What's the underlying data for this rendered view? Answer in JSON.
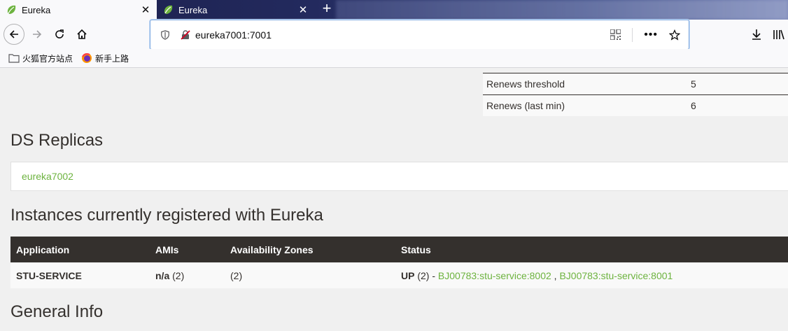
{
  "browser": {
    "tabs": [
      {
        "title": "Eureka",
        "active": true
      },
      {
        "title": "Eureka",
        "active": false
      }
    ],
    "new_tab_label": "+",
    "url": "eureka7001:7001",
    "bookmarks": [
      {
        "label": "火狐官方站点",
        "icon": "folder-icon"
      },
      {
        "label": "新手上路",
        "icon": "firefox-icon"
      }
    ]
  },
  "renewals": [
    {
      "label": "Renews threshold",
      "value": "5"
    },
    {
      "label": "Renews (last min)",
      "value": "6"
    }
  ],
  "ds_replicas": {
    "heading": "DS Replicas",
    "items": [
      "eureka7002"
    ]
  },
  "instances": {
    "heading": "Instances currently registered with Eureka",
    "columns": [
      "Application",
      "AMIs",
      "Availability Zones",
      "Status"
    ],
    "rows": [
      {
        "application": "STU-SERVICE",
        "amis_bold": "n/a",
        "amis_count": "(2)",
        "zones": "(2)",
        "status": "UP",
        "status_count": "(2) -",
        "instances": [
          "BJ00783:stu-service:8002",
          "BJ00783:stu-service:8001"
        ],
        "separator": ","
      }
    ]
  },
  "general_info": {
    "heading": "General Info"
  },
  "colors": {
    "accent_green": "#6db33f",
    "table_header": "#34302d",
    "tab_bar": "#1b1f4a"
  }
}
